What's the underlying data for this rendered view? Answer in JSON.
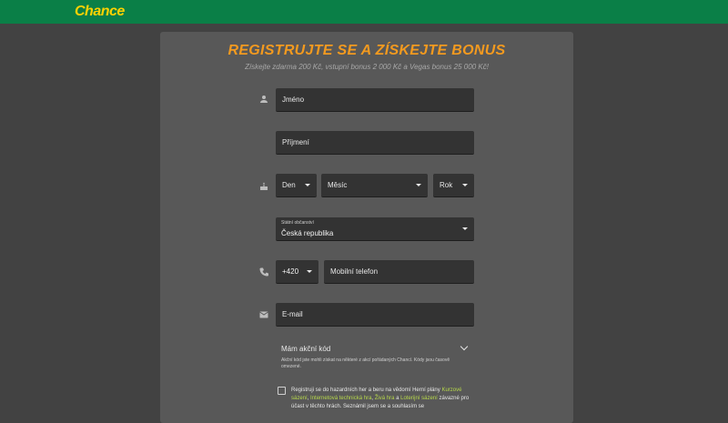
{
  "brand": {
    "logo_text": "Chance",
    "color_primary": "#0a7f47",
    "color_logo": "#ffd200",
    "color_title": "#f39a1f"
  },
  "form": {
    "title": "REGISTRUJTE SE A ZÍSKEJTE BONUS",
    "subtitle": "Získejte zdarma 200 Kč, vstupní bonus 2 000 Kč a Vegas bonus 25 000 Kč!",
    "first_name": {
      "placeholder": "Jméno",
      "icon": "person-icon"
    },
    "last_name": {
      "placeholder": "Příjmení"
    },
    "birth": {
      "icon": "cake-icon",
      "day": "Den",
      "month": "Měsíc",
      "year": "Rok"
    },
    "citizenship": {
      "label": "Státní občanství",
      "value": "Česká republika"
    },
    "phone": {
      "icon": "phone-icon",
      "prefix": "+420",
      "placeholder": "Mobilní telefon"
    },
    "email": {
      "icon": "mail-icon",
      "placeholder": "E-mail"
    },
    "promo": {
      "label": "Mám akční kód",
      "note": "Akční kód jste mohli získat na některé z akcí pořádaných Chancí. Kódy jsou časově omezené."
    },
    "terms": {
      "text_1": "Registruji se do hazardních her a beru na vědomí Herní plány ",
      "link_1": "Kurzové sázení",
      "sep_1": ", ",
      "link_2": "Internetová technická hra",
      "sep_2": ", ",
      "link_3": "Živá hra",
      "sep_3": " a ",
      "link_4": "Loterijní sázení",
      "text_2": " závazné pro účast v těchto hrách. Seznámil jsem se a souhlasím se"
    }
  }
}
